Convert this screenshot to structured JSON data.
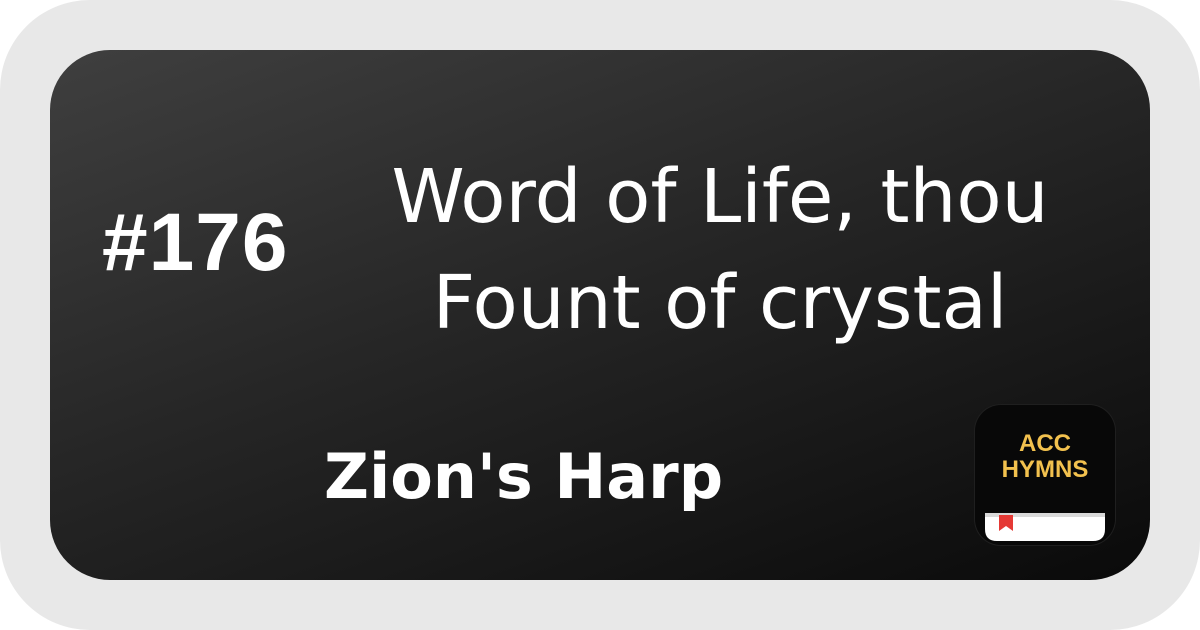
{
  "hymn": {
    "number": "#176",
    "title_line1": "Word of Life, thou",
    "title_line2": "Fount of crystal",
    "book": "Zion's Harp"
  },
  "logo": {
    "line1": "ACC",
    "line2": "HYMNS",
    "text_color": "#f2c14e",
    "bookmark_color": "#e53935",
    "icon": "book-icon"
  },
  "colors": {
    "frame": "#e8e8e8",
    "card_dark": "#0a0a0a",
    "card_light": "#3f3f3f",
    "text": "#ffffff"
  }
}
